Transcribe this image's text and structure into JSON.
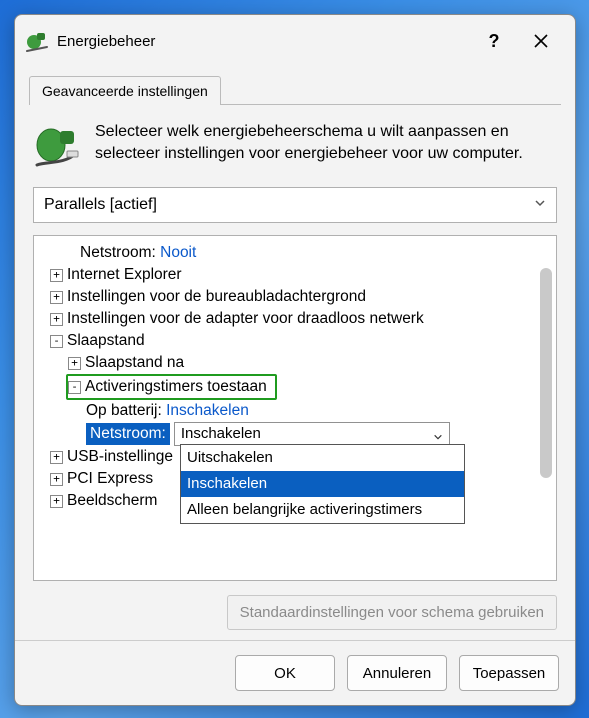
{
  "window": {
    "title": "Energiebeheer",
    "help_glyph": "?",
    "close_tooltip": "Close"
  },
  "tab": {
    "label": "Geavanceerde instellingen"
  },
  "intro": {
    "text": "Selecteer welk energiebeheerschema u wilt aanpassen en selecteer instellingen voor energiebeheer voor uw computer."
  },
  "plan": {
    "selected": "Parallels [actief]"
  },
  "tree": {
    "netstroom_label": "Netstroom:",
    "netstroom_value": "Nooit",
    "items": {
      "ie": "Internet Explorer",
      "bg": "Instellingen voor de bureaubladachtergrond",
      "wifi": "Instellingen voor de adapter voor draadloos netwerk",
      "sleep": "Slaapstand",
      "sleep_after": "Slaapstand na",
      "wake": "Activeringstimers toestaan",
      "on_battery_label": "Op batterij:",
      "on_battery_value": "Inschakelen",
      "plugged_label": "Netstroom:",
      "plugged_value": "Inschakelen",
      "usb": "USB-instellinge",
      "pci": "PCI Express",
      "display": "Beeldscherm"
    }
  },
  "dropdown": {
    "options": [
      "Uitschakelen",
      "Inschakelen",
      "Alleen belangrijke activeringstimers"
    ],
    "selected_index": 1
  },
  "restore": {
    "label": "Standaardinstellingen voor schema gebruiken"
  },
  "buttons": {
    "ok": "OK",
    "cancel": "Annuleren",
    "apply": "Toepassen"
  }
}
